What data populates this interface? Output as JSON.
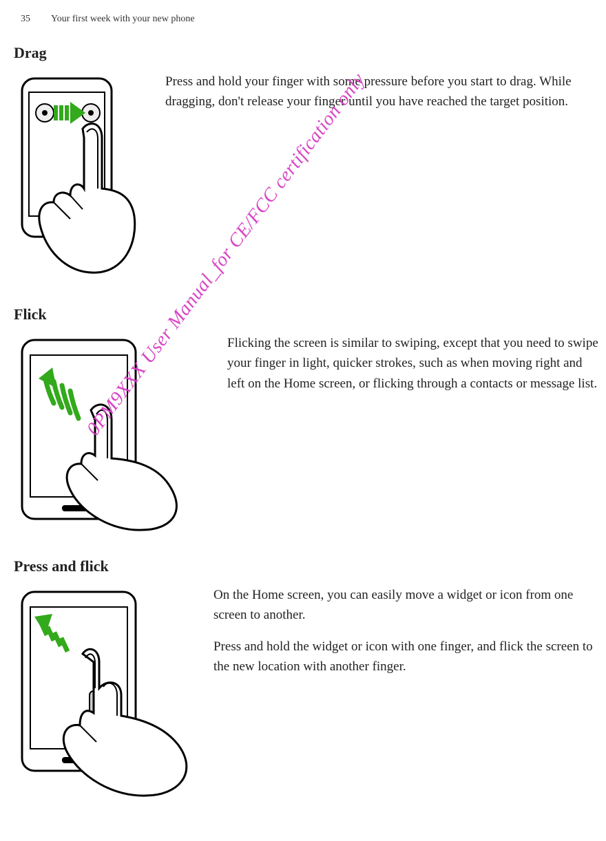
{
  "header": {
    "page_number": "35",
    "chapter": "Your first week with your new phone"
  },
  "sections": {
    "drag": {
      "title": "Drag",
      "paragraphs": [
        "Press and hold your finger with some pressure before you start to drag. While dragging, don't release your finger until you have reached the target position."
      ]
    },
    "flick": {
      "title": "Flick",
      "paragraphs": [
        "Flicking the screen is similar to swiping, except that you need to swipe your finger in light, quicker strokes, such as when moving right and left on the Home screen, or flicking through a contacts or message list."
      ]
    },
    "press_and_flick": {
      "title": "Press and flick",
      "paragraphs": [
        "On the Home screen, you can easily move a widget or icon from one screen to another.",
        "Press and hold the widget or icon with one finger, and flick the screen to the new location with another finger."
      ]
    }
  },
  "watermark": "0PM9XXX User Manual_for CE/FCC certification only"
}
